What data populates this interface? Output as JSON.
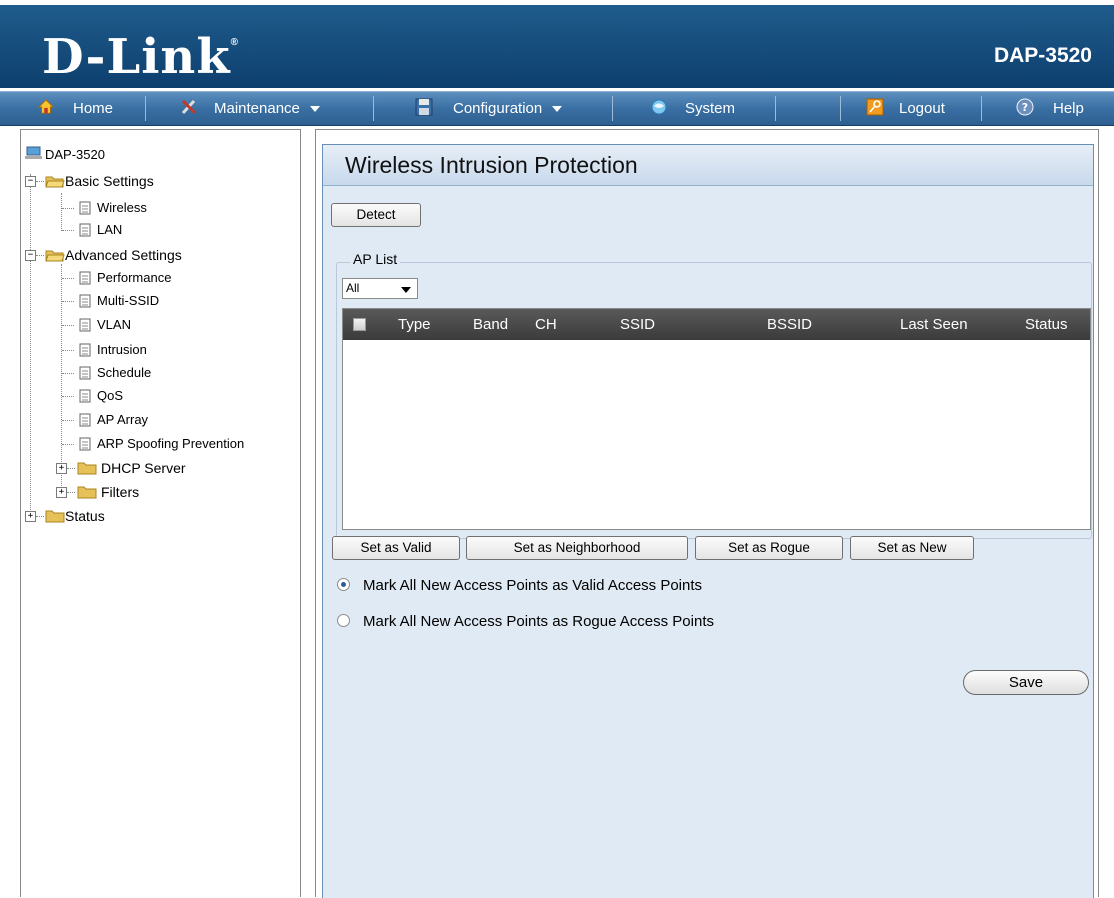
{
  "header": {
    "logo": "D-Link",
    "trademark": "®",
    "model": "DAP-3520"
  },
  "nav": {
    "home": "Home",
    "maintenance": "Maintenance",
    "configuration": "Configuration",
    "system": "System",
    "logout": "Logout",
    "help": "Help"
  },
  "sidebar": {
    "root": "DAP-3520",
    "basic": "Basic Settings",
    "wireless": "Wireless",
    "lan": "LAN",
    "advanced": "Advanced Settings",
    "performance": "Performance",
    "multi_ssid": "Multi-SSID",
    "vlan": "VLAN",
    "intrusion": "Intrusion",
    "schedule": "Schedule",
    "qos": "QoS",
    "ap_array": "AP Array",
    "arp": "ARP Spoofing Prevention",
    "dhcp": "DHCP Server",
    "filters": "Filters",
    "status": "Status"
  },
  "main": {
    "title": "Wireless Intrusion Protection",
    "detect": "Detect",
    "ap_list_legend": "AP List",
    "filter_value": "All",
    "columns": {
      "type": "Type",
      "band": "Band",
      "ch": "CH",
      "ssid": "SSID",
      "bssid": "BSSID",
      "last_seen": "Last Seen",
      "status": "Status"
    },
    "set_valid": "Set as Valid",
    "set_neighborhood": "Set as Neighborhood",
    "set_rogue": "Set as Rogue",
    "set_new": "Set as New",
    "radio_valid": "Mark All New Access Points as Valid Access Points",
    "radio_rogue": "Mark All New Access Points as Rogue Access Points",
    "save": "Save"
  },
  "colors": {
    "header_blue": "#0d3f6e",
    "nav_blue": "#3a6fa3",
    "panel_bg": "#dfeaf5",
    "table_header": "#3b3b3b"
  }
}
